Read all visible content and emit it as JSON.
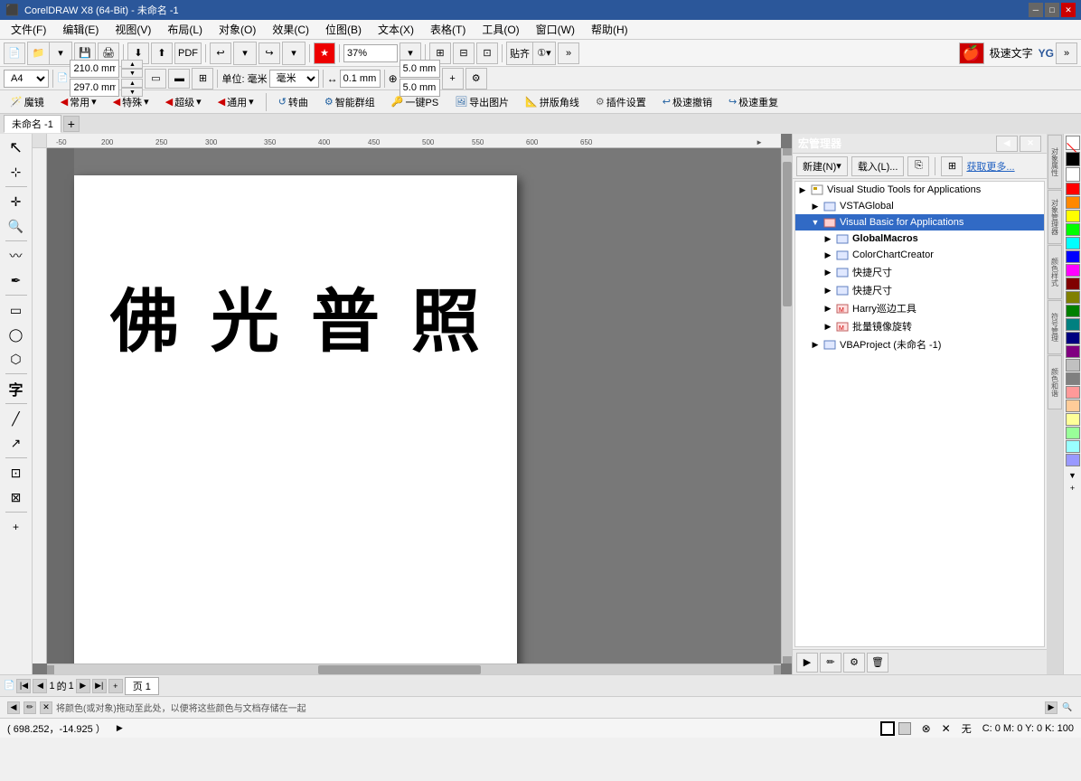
{
  "titlebar": {
    "title": "CorelDRAW X8 (64-Bit) - 未命名 -1",
    "minimize": "─",
    "restore": "□",
    "close": "✕"
  },
  "menu": {
    "items": [
      "文件(F)",
      "编辑(E)",
      "视图(V)",
      "布局(L)",
      "对象(O)",
      "效果(C)",
      "位图(B)",
      "文本(X)",
      "表格(T)",
      "工具(O)",
      "窗口(W)",
      "帮助(H)"
    ]
  },
  "page": {
    "size": "A4",
    "width": "210.0 mm",
    "height": "297.0 mm",
    "unit": "毫米",
    "nudge": "0.1 mm",
    "x": "5.0 mm",
    "y": "5.0 mm",
    "zoom": "37%"
  },
  "tab": {
    "name": "未命名 -1"
  },
  "canvas_text": "佛 光 普 照",
  "macros": {
    "panel_title": "宏管理器",
    "new_label": "新建(N)",
    "load_label": "载入(L)...",
    "get_more_label": "获取更多...",
    "tree": [
      {
        "level": 0,
        "label": "Visual Studio Tools for Applications",
        "toggle": "▶",
        "icon": "folder"
      },
      {
        "level": 1,
        "label": "VSTAGlobal",
        "toggle": "▶",
        "icon": "module"
      },
      {
        "level": 1,
        "label": "Visual Basic for Applications",
        "toggle": "▼",
        "icon": "folder",
        "selected": true
      },
      {
        "level": 2,
        "label": "GlobalMacros",
        "toggle": "▶",
        "icon": "module"
      },
      {
        "level": 2,
        "label": "ColorChartCreator",
        "toggle": "▶",
        "icon": "module"
      },
      {
        "level": 2,
        "label": "快捷尺寸",
        "toggle": "▶",
        "icon": "module"
      },
      {
        "level": 2,
        "label": "快捷尺寸",
        "toggle": "▶",
        "icon": "module"
      },
      {
        "level": 2,
        "label": "Harry巡边工具",
        "toggle": "▶",
        "icon": "module-red"
      },
      {
        "level": 2,
        "label": "批量镜像旋转",
        "toggle": "▶",
        "icon": "module-red"
      },
      {
        "level": 1,
        "label": "VBAProject (未命名 -1)",
        "toggle": "▶",
        "icon": "module"
      }
    ]
  },
  "plugins": {
    "items": [
      {
        "icon": "🪄",
        "label": "魔镜"
      },
      {
        "icon": "▶",
        "label": "常用"
      },
      {
        "icon": "▶",
        "label": "特殊"
      },
      {
        "icon": "▶",
        "label": "超级"
      },
      {
        "icon": "▶",
        "label": "通用"
      },
      {
        "icon": "↩",
        "label": "转曲"
      },
      {
        "icon": "⚙",
        "label": "智能群组"
      },
      {
        "icon": "🔑",
        "label": "一键PS"
      },
      {
        "icon": "🖼",
        "label": "导出图片"
      },
      {
        "icon": "📐",
        "label": "拼版角线"
      },
      {
        "icon": "⚙",
        "label": "插件设置"
      },
      {
        "icon": "↩",
        "label": "极速撤销"
      },
      {
        "icon": "↪",
        "label": "极速重复"
      }
    ]
  },
  "statusbar": {
    "coords": "( 698.252，-14.925 ）",
    "fill": "C: 0 M: 0 Y: 0 K: 100",
    "bottom_text": "将颜色(或对象)拖动至此处，以便将这些颜色与文档存储在一起"
  },
  "colors": [
    "#ffffff",
    "#000000",
    "#ff0000",
    "#ff8800",
    "#ffff00",
    "#00ff00",
    "#00ffff",
    "#0000ff",
    "#ff00ff",
    "#800000",
    "#808000",
    "#008000",
    "#008080",
    "#000080",
    "#800080",
    "#c0c0c0",
    "#808080",
    "#ff9999",
    "#ffcc99",
    "#ffff99",
    "#99ff99",
    "#99ffff",
    "#9999ff"
  ]
}
